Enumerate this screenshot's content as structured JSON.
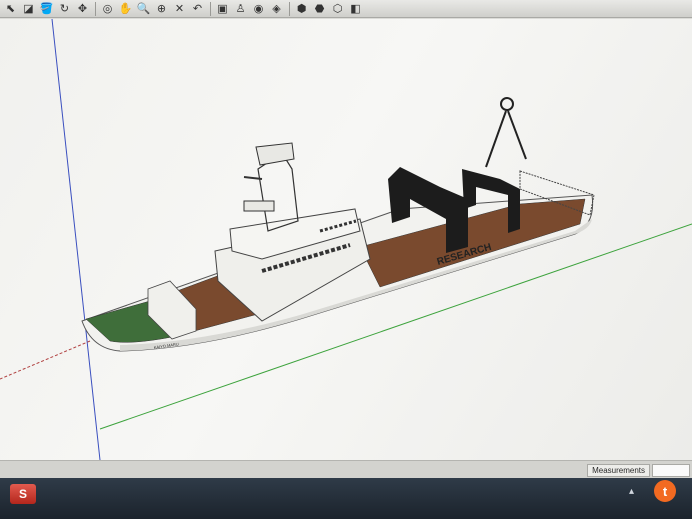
{
  "toolbar": {
    "icons": [
      {
        "name": "select-icon",
        "glyph": "⬉"
      },
      {
        "name": "eraser-icon",
        "glyph": "◪"
      },
      {
        "name": "paint-bucket-icon",
        "glyph": "🪣"
      },
      {
        "name": "rotate-icon",
        "glyph": "↻"
      },
      {
        "name": "move-icon",
        "glyph": "✥"
      },
      {
        "name": "orbit-icon",
        "glyph": "◎"
      },
      {
        "name": "pan-icon",
        "glyph": "✋"
      },
      {
        "name": "zoom-icon",
        "glyph": "🔍"
      },
      {
        "name": "zoom-window-icon",
        "glyph": "⊕"
      },
      {
        "name": "zoom-extents-icon",
        "glyph": "✕"
      },
      {
        "name": "previous-view-icon",
        "glyph": "↶"
      },
      {
        "name": "position-camera-icon",
        "glyph": "▣"
      },
      {
        "name": "walk-icon",
        "glyph": "♙"
      },
      {
        "name": "look-around-icon",
        "glyph": "◉"
      },
      {
        "name": "section-plane-icon",
        "glyph": "◈"
      },
      {
        "name": "warehouse-icon",
        "glyph": "⬢"
      },
      {
        "name": "extension-warehouse-icon",
        "glyph": "⬣"
      },
      {
        "name": "share-model-icon",
        "glyph": "⬡"
      },
      {
        "name": "layout-icon",
        "glyph": "◧"
      }
    ]
  },
  "model": {
    "hull_text": "RESEARCH",
    "bow_name": "KAIYO MARU"
  },
  "statusbar": {
    "measurements_label": "Measurements",
    "measurements_value": ""
  },
  "taskbar": {
    "app_glyph": "S",
    "tray_badge": "t"
  },
  "colors": {
    "viewport_bg": "#f4f4f1",
    "hull": "#f2f2ef",
    "deck": "#7a4a2e",
    "bow_deck": "#3f6e3a",
    "crane": "#1c1c1c",
    "axis_green": "#3da33d",
    "axis_blue": "#3a4fbf"
  }
}
